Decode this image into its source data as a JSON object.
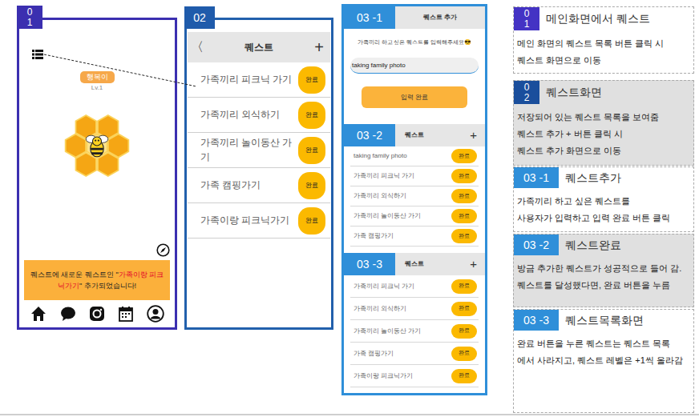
{
  "main_screen": {
    "label": "01",
    "pet": {
      "name": "행복이",
      "level": "Lv.1"
    },
    "notification": {
      "before": "퀘스트에 새로운 퀘스트인 \"",
      "highlight": "가족이랑 피크닉가기",
      "after": "\" 추가되었습니다!"
    }
  },
  "quest_screen": {
    "label": "02",
    "back": "〈",
    "title": "퀘스트",
    "add": "+",
    "items": [
      {
        "text": "가족끼리 피크닉 가기",
        "button": "완료"
      },
      {
        "text": "가족끼리 외식하기",
        "button": "완료"
      },
      {
        "text": "가족끼리 놀이동산 가기",
        "button": "완료"
      },
      {
        "text": "가족 캠핑가기",
        "button": "완료"
      },
      {
        "text": "가족이랑 피크닉가기",
        "button": "완료"
      }
    ]
  },
  "add_screen": {
    "label": "03 -1",
    "title": "퀘스트 추가",
    "prompt": "가족끼리 하고 싶은 퀘스트를 입력해주세요😎",
    "input": "taking family photo",
    "submit": "입력 완료"
  },
  "added_screen": {
    "label": "03 -2",
    "title": "퀘스트",
    "add": "+",
    "items": [
      {
        "text": "taking family photo",
        "button": "완료"
      },
      {
        "text": "가족끼리 피크닉 가기",
        "button": "완료"
      },
      {
        "text": "가족끼리 외식하기",
        "button": "완료"
      },
      {
        "text": "가족끼리 놀이동산 가기",
        "button": "완료"
      },
      {
        "text": "가족 캠핑가기",
        "button": "완료"
      }
    ]
  },
  "list_screen": {
    "label": "03 -3",
    "title": "퀘스트",
    "add": "+",
    "items": [
      {
        "text": "가족끼리 피크닉 가기",
        "button": "완료"
      },
      {
        "text": "가족끼리 외식하기",
        "button": "완료"
      },
      {
        "text": "가족끼리 놀이동산 가기",
        "button": "완료"
      },
      {
        "text": "가족 캠핑가기",
        "button": "완료"
      },
      {
        "text": "가족이랑 피크닉가기",
        "button": "완료"
      }
    ]
  },
  "notes": [
    {
      "label": "01",
      "kind": "stacked",
      "color": "#4433c4",
      "shaded": false,
      "title": "메인화면에서 퀘스트",
      "lines": [
        "메인 화면의 퀘스트 목록 버튼 클릭 시",
        "퀘스트 화면으로 이동"
      ]
    },
    {
      "label": "02",
      "kind": "stacked",
      "color": "#1a4e9c",
      "shaded": true,
      "title": "퀘스트화면",
      "lines": [
        "저장되어 있는 퀘스트 목록을 보여줌",
        "퀘스트 추가 + 버튼 클릭 시",
        "퀘스트 추가 화면으로 이동"
      ]
    },
    {
      "label": "03 -1",
      "kind": "inline",
      "color": "#2f8fd9",
      "shaded": false,
      "title": "퀘스트추가",
      "lines": [
        "가족끼리 하고 싶은 퀘스트를",
        "사용자가 입력하고  입력 완료 버튼 클릭"
      ]
    },
    {
      "label": "03 -2",
      "kind": "inline",
      "color": "#2f8fd9",
      "shaded": true,
      "title": "퀘스트완료",
      "lines": [
        "방금 추가한 퀘스트가 성공적으로 들어 감.",
        "퀘스트를 달성했다면, 완료 버튼을 누름"
      ]
    },
    {
      "label": "03 -3",
      "kind": "inline",
      "color": "#2f8fd9",
      "shaded": false,
      "title": "퀘스트목록화면",
      "lines": [
        "완료 버튼을 누른 퀘스트는 퀘스트 목록",
        "에서 사라지고, 퀘스트 레벨은 +1씩 올라감"
      ]
    }
  ]
}
